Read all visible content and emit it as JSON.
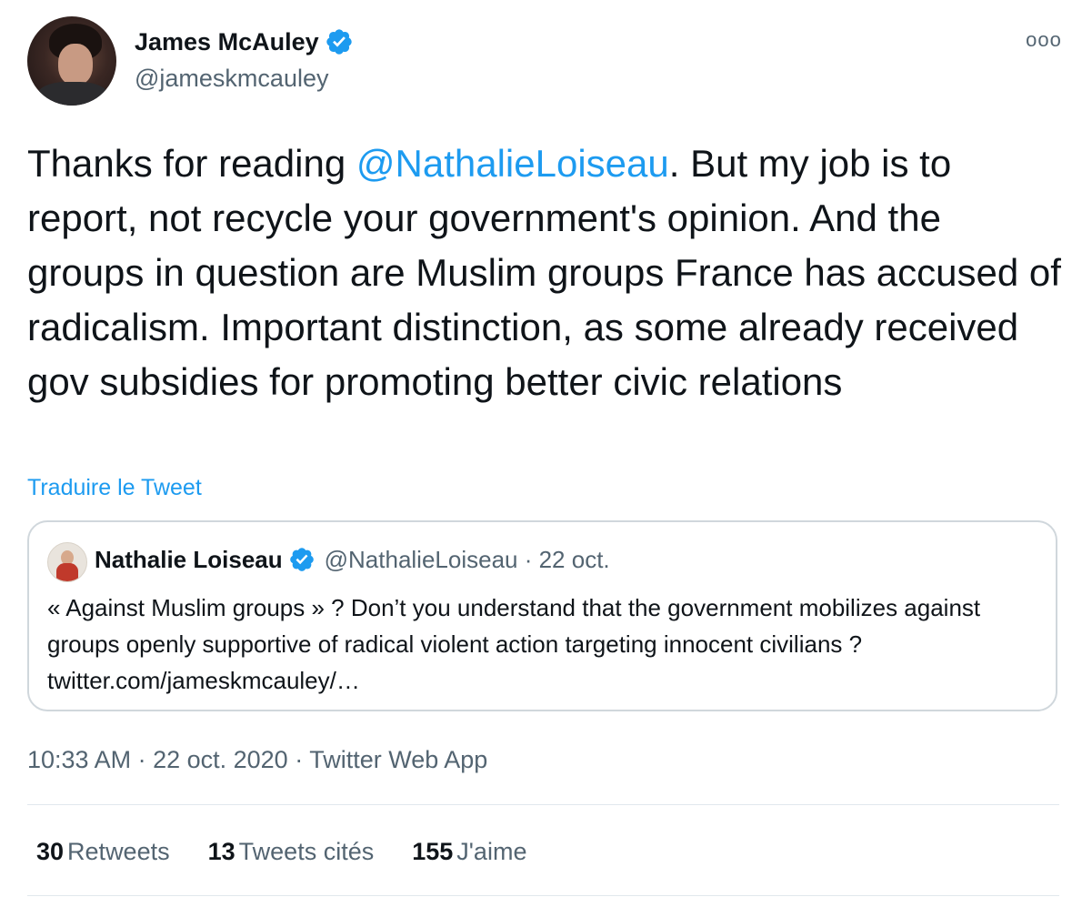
{
  "tweet": {
    "author_name": "James McAuley",
    "author_handle": "@jameskmcauley",
    "more_label": "ooo",
    "text_before": "Thanks for reading ",
    "mention": "@NathalieLoiseau",
    "text_after": ". But my job is to report, not recycle your government's opinion. And the groups in question are Muslim groups France has accused of radicalism. Important distinction, as some already received gov subsidies for promoting better civic relations",
    "translate_label": "Traduire le Tweet",
    "timestamp": "10:33 AM · 22 oct. 2020 · ",
    "source": "Twitter Web App"
  },
  "quoted_tweet": {
    "author_name": "Nathalie Loiseau",
    "meta": "@NathalieLoiseau · 22 oct.",
    "text": "« Against Muslim groups » ? Don’t you understand that the government mobilizes against groups openly supportive of radical violent action targeting innocent civilians ? twitter.com/jameskmcauley/…"
  },
  "stats": [
    {
      "count": "30",
      "label": "Retweets"
    },
    {
      "count": "13",
      "label": "Tweets cités"
    },
    {
      "count": "155",
      "label": "J'aime"
    }
  ],
  "colors": {
    "accent": "#1d9bf0",
    "secondary_text": "#536471",
    "border": "#d0d7dc"
  }
}
